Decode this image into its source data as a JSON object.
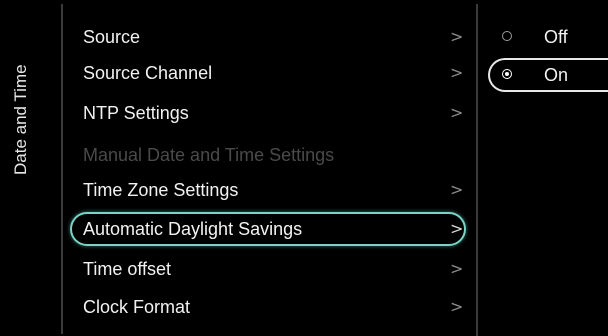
{
  "sidebar": {
    "title": "Date and Time"
  },
  "menu": {
    "items": [
      {
        "label": "Source",
        "chevron": ">",
        "state": "normal"
      },
      {
        "label": "Source Channel",
        "chevron": ">",
        "state": "normal"
      },
      {
        "label": "NTP Settings",
        "chevron": ">",
        "state": "normal"
      },
      {
        "label": "Manual Date and Time Settings",
        "chevron": "",
        "state": "disabled"
      },
      {
        "label": "Time Zone Settings",
        "chevron": ">",
        "state": "normal"
      },
      {
        "label": "Automatic Daylight Savings",
        "chevron": ">",
        "state": "selected"
      },
      {
        "label": "Time offset",
        "chevron": ">",
        "state": "normal"
      },
      {
        "label": "Clock Format",
        "chevron": ">",
        "state": "normal"
      }
    ]
  },
  "options": {
    "items": [
      {
        "label": "Off",
        "checked": false
      },
      {
        "label": "On",
        "checked": true
      }
    ]
  },
  "colors": {
    "background": "#000000",
    "focus_ring": "#7bd4c6",
    "text": "#f2f2f2",
    "disabled_text": "#4a4a4a"
  }
}
